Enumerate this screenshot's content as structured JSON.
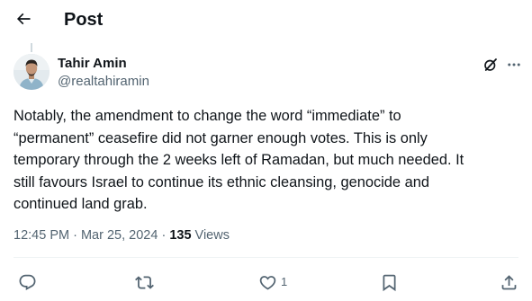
{
  "header": {
    "title": "Post",
    "back_icon": "arrow-left-icon"
  },
  "author": {
    "name": "Tahir Amin",
    "handle": "@realtahiramin",
    "avatar_icon": "profile-photo"
  },
  "post": {
    "lines": [
      "Notably, the amendment to change the word “immediate” to",
      "“permanent” ceasefire did not garner enough votes. This is only",
      "temporary through the 2 weeks left of Ramadan, but much needed. It",
      "still favours Israel to continue its ethnic cleansing, genocide and",
      "continued land grab."
    ]
  },
  "meta": {
    "time": "12:45 PM",
    "sep1": " · ",
    "date": "Mar 25, 2024",
    "sep2": " · ",
    "views_count": "135",
    "views_label": " Views"
  },
  "actions": {
    "reply_icon": "reply-icon",
    "repost_icon": "repost-icon",
    "like_icon": "heart-icon",
    "like_count": "1",
    "bookmark_icon": "bookmark-icon",
    "share_icon": "share-icon"
  },
  "colors": {
    "text_primary": "#0f1419",
    "text_secondary": "#536471",
    "divider": "#eff3f4"
  }
}
